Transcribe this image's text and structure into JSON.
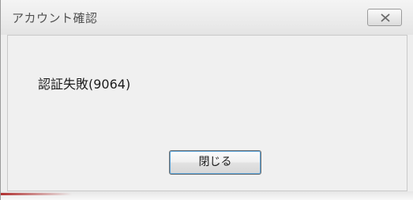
{
  "window": {
    "title": "アカウント確認"
  },
  "dialog": {
    "message": "認証失敗(9064)",
    "close_button_label": "閉じる"
  },
  "icons": {
    "title_close": "close-icon"
  }
}
